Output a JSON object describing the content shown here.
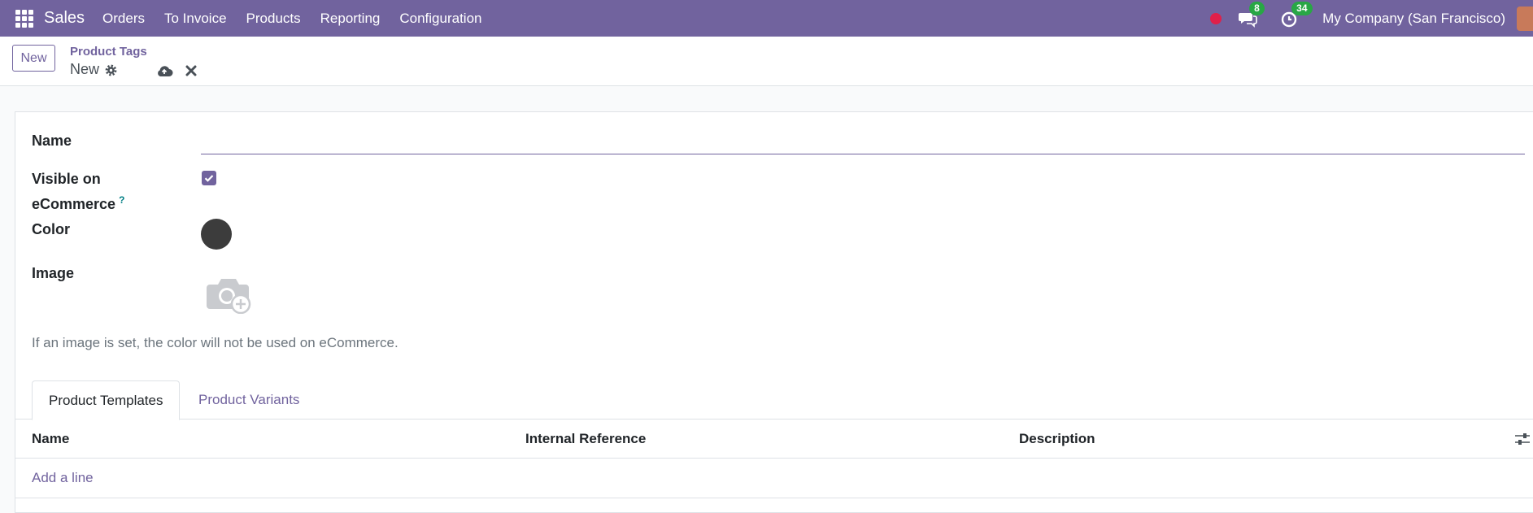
{
  "navbar": {
    "app_name": "Sales",
    "menu": [
      "Orders",
      "To Invoice",
      "Products",
      "Reporting",
      "Configuration"
    ],
    "messages_count": "8",
    "activities_count": "34",
    "company": "My Company (San Francisco)",
    "brand_color": "#71639e"
  },
  "control": {
    "new_label": "New",
    "breadcrumb_parent": "Product Tags",
    "breadcrumb_current": "New"
  },
  "form": {
    "name_label": "Name",
    "name_value": "",
    "visible_label": "Visible on eCommerce",
    "visible_help": "?",
    "visible_checked": true,
    "color_label": "Color",
    "color_value": "#3c3c3c",
    "image_label": "Image",
    "hint": "If an image is set, the color will not be used on eCommerce."
  },
  "tabs": [
    {
      "label": "Product Templates",
      "active": true
    },
    {
      "label": "Product Variants",
      "active": false
    }
  ],
  "table": {
    "columns": [
      "Name",
      "Internal Reference",
      "Description"
    ],
    "add_line": "Add a line"
  }
}
